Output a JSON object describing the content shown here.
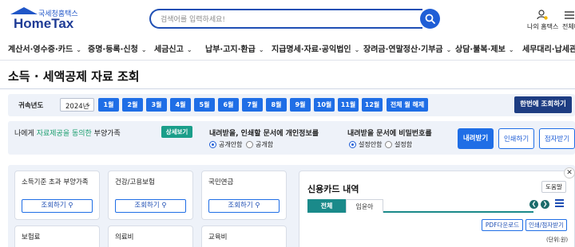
{
  "header": {
    "logo_sub": "국세청홈택스",
    "logo_main": "HomeTax",
    "search_placeholder": "검색어를 입력하세요!",
    "my_hometax": "나의 홈택스",
    "all_menu": "전체메"
  },
  "gnb": [
    {
      "label": "계산서·영수증·카드"
    },
    {
      "label": "증명·등록·신청"
    },
    {
      "label": "세금신고"
    },
    {
      "label": "납부·고지·환급"
    },
    {
      "label": "지급명세·자료·공익법인"
    },
    {
      "label": "장려금·연말정산·기부금"
    },
    {
      "label": "상담·불복·제보"
    },
    {
      "label": "세무대리·납세관리"
    }
  ],
  "page_title": "소득 · 세액공제 자료 조회",
  "year_bar": {
    "label": "귀속년도",
    "year": "2024년",
    "months": [
      "1월",
      "2월",
      "3월",
      "4월",
      "5월",
      "6월",
      "7월",
      "8월",
      "9월",
      "10월",
      "11월",
      "12월"
    ],
    "cancel_all": "전체 월 해제",
    "query_all": "한번에 조회하기"
  },
  "options": {
    "consent_prefix": "나에게 ",
    "consent_highlight": "자료제공을 동의한",
    "consent_suffix": " 부양가족",
    "detail_button": "상세보기",
    "q_personal": "내려받을, 인쇄할 문서에 개인정보를",
    "personal_opt1": "공개안함",
    "personal_opt2": "공개함",
    "q_password": "내려받을 문서에 비밀번호를",
    "password_opt1": "설정안함",
    "password_opt2": "설정함",
    "download": "내려받기",
    "print": "인쇄하기",
    "braille": "점자받기"
  },
  "cards": [
    {
      "title": "소득기준 초과 부양가족",
      "button": "조회하기"
    },
    {
      "title": "건강/고용보험",
      "button": "조회하기"
    },
    {
      "title": "국민연금",
      "button": "조회하기"
    },
    {
      "title": "보험료"
    },
    {
      "title": "의료비"
    },
    {
      "title": "교육비"
    }
  ],
  "detail": {
    "title": "신용카드 내역",
    "help": "도움말",
    "tab_all": "전체",
    "tab_other": "임윤아",
    "pdf_download": "PDF다운로드",
    "print_braille": "인쇄/점자받기",
    "unit": "(단위:원)"
  },
  "colors": {
    "primary": "#1f6ee6",
    "navy": "#1d3c82",
    "teal": "#1a8a8a",
    "green": "#1a9e6e"
  }
}
